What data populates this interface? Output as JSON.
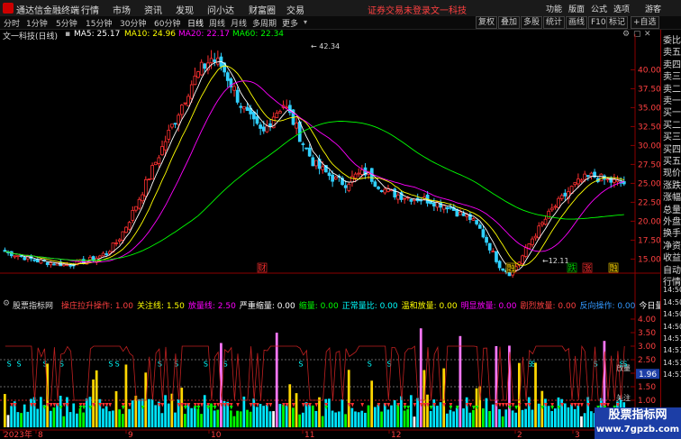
{
  "title_bar": {
    "app_name": "通达信金融终端",
    "menus": [
      "行情",
      "市场",
      "资讯",
      "发现",
      "问小达",
      "财富圈",
      "交易"
    ],
    "notice": "证券交易未登录",
    "stock_link": "文一科技",
    "right_menus": [
      "功能",
      "版面",
      "公式",
      "选项",
      "游客"
    ]
  },
  "toolbar": {
    "periods": [
      "分时",
      "1分钟",
      "5分钟",
      "15分钟",
      "30分钟",
      "60分钟",
      "日线",
      "周线",
      "月线",
      "多周期",
      "更多"
    ],
    "active_period": "日线",
    "right_buttons": [
      "复权",
      "叠加",
      "多股",
      "统计",
      "画线",
      "F10",
      "标记",
      "+自选"
    ]
  },
  "info_line": {
    "stock": "文一科技(日线)",
    "ma5": "MA5: 25.17",
    "ma10": "MA10: 24.96",
    "ma20": "MA20: 22.17",
    "ma60": "MA60: 22.34"
  },
  "price_axis": [
    "40.00",
    "37.50",
    "35.00",
    "32.50",
    "30.00",
    "27.50",
    "25.00",
    "22.50",
    "20.00",
    "17.50",
    "15.00"
  ],
  "annotations": {
    "high": "42.34",
    "low": "12.11",
    "events": [
      "财",
      "融",
      "跌",
      "涨",
      "融"
    ]
  },
  "indicator_line": {
    "name": "股票指标网",
    "items": [
      {
        "label": "操庄拉升操作:",
        "value": "1.00",
        "color": "#ff4040"
      },
      {
        "label": "关注线:",
        "value": "1.50",
        "color": "#ffff00"
      },
      {
        "label": "放量线:",
        "value": "2.50",
        "color": "#ff00ff"
      },
      {
        "label": "严重缩量:",
        "value": "0.00",
        "color": "#ffffff"
      },
      {
        "label": "缩量:",
        "value": "0.00",
        "color": "#00ff00"
      },
      {
        "label": "正常量比:",
        "value": "0.00",
        "color": "#00ffff"
      },
      {
        "label": "温和放量:",
        "value": "0.00",
        "color": "#ffff00"
      },
      {
        "label": "明显放量:",
        "value": "0.00",
        "color": "#ff00ff"
      },
      {
        "label": "剧烈放量:",
        "value": "0.00",
        "color": "#ff4040"
      },
      {
        "label": "反向操作:",
        "value": "0.00",
        "color": "#3399ff"
      },
      {
        "label": "今日量比:",
        "value": "0.59",
        "color": "#ffffff"
      }
    ]
  },
  "indicator_axis": [
    "4.00",
    "3.50",
    "3.00",
    "2.50",
    "2.00",
    "1.50",
    "1.00",
    "0.50"
  ],
  "indicator_markers": {
    "current": "1.96",
    "fangliang": "放量",
    "guanzhu": "关注"
  },
  "time_axis": [
    "2023年",
    "8",
    "9",
    "10",
    "11",
    "12",
    "2",
    "3"
  ],
  "right_panel": {
    "items": [
      {
        "label": "委比",
        "color": "#dddddd"
      },
      {
        "label": "卖五",
        "color": "#dddddd"
      },
      {
        "label": "卖四",
        "color": "#dddddd"
      },
      {
        "label": "卖三",
        "color": "#dddddd"
      },
      {
        "label": "卖二",
        "color": "#dddddd"
      },
      {
        "label": "卖一",
        "color": "#dddddd"
      },
      {
        "label": "买一",
        "color": "#dddddd"
      },
      {
        "label": "买二",
        "color": "#dddddd"
      },
      {
        "label": "买三",
        "color": "#dddddd"
      },
      {
        "label": "买四",
        "color": "#dddddd"
      },
      {
        "label": "买五",
        "color": "#dddddd"
      },
      {
        "label": "现价",
        "color": "#dddddd"
      },
      {
        "label": "涨跌",
        "color": "#dddddd"
      },
      {
        "label": "涨幅",
        "color": "#dddddd"
      },
      {
        "label": "总量",
        "color": "#dddddd"
      },
      {
        "label": "外盘",
        "color": "#dddddd"
      },
      {
        "label": "换手",
        "color": "#dddddd"
      },
      {
        "label": "净资",
        "color": "#dddddd"
      },
      {
        "label": "收益",
        "color": "#dddddd"
      },
      {
        "label": "自动",
        "color": "#dddddd"
      },
      {
        "label": "行情",
        "color": "#dddddd"
      },
      {
        "label": "14:50",
        "color": "#dddddd"
      },
      {
        "label": "14:50",
        "color": "#dddddd"
      },
      {
        "label": "14:50",
        "color": "#dddddd"
      },
      {
        "label": "14:50",
        "color": "#dddddd"
      },
      {
        "label": "14:51",
        "color": "#dddddd"
      },
      {
        "label": "14:51",
        "color": "#dddddd"
      },
      {
        "label": "14:51",
        "color": "#dddddd"
      },
      {
        "label": "14:51",
        "color": "#dddddd"
      }
    ]
  },
  "watermark": {
    "title": "股票指标网",
    "url": "www.7gpzb.com"
  },
  "colors": {
    "up": "#ff3030",
    "down": "#30d0ff",
    "ma5": "#ffffff",
    "ma10": "#ffff00",
    "ma20": "#ff00ff",
    "ma60": "#00ff00",
    "ref_line": "#c02020"
  },
  "chart_data": [
    {
      "type": "candlestick",
      "title": "文一科技(日线)",
      "ylim": [
        13.5,
        43.5
      ],
      "series": [
        {
          "name": "MA5",
          "values": []
        },
        {
          "name": "MA10",
          "values": []
        },
        {
          "name": "MA20",
          "values": []
        },
        {
          "name": "MA60",
          "values": []
        }
      ],
      "price_path": [
        16.0,
        15.6,
        15.2,
        14.8,
        14.6,
        14.4,
        14.3,
        14.5,
        14.8,
        15.2,
        16.0,
        17.5,
        20.0,
        23.0,
        26.0,
        29.0,
        32.0,
        35.0,
        38.0,
        40.0,
        41.5,
        40.5,
        38.0,
        35.0,
        33.0,
        31.5,
        34.0,
        35.5,
        33.0,
        30.0,
        27.5,
        26.5,
        25.5,
        25.0,
        26.0,
        26.5,
        25.0,
        24.0,
        23.5,
        23.2,
        23.0,
        22.8,
        22.4,
        22.0,
        21.0,
        20.5,
        19.0,
        16.5,
        14.0,
        13.0,
        15.0,
        17.5,
        19.5,
        21.5,
        23.0,
        24.5,
        25.5,
        26.0,
        25.5,
        25.2,
        25.0
      ],
      "high": 42.34,
      "low": 12.11
    },
    {
      "type": "bar",
      "title": "股票指标网",
      "ylim": [
        0,
        4.3
      ],
      "reference_lines": [
        1.0,
        1.5,
        2.5
      ],
      "current_value": 1.96
    }
  ]
}
